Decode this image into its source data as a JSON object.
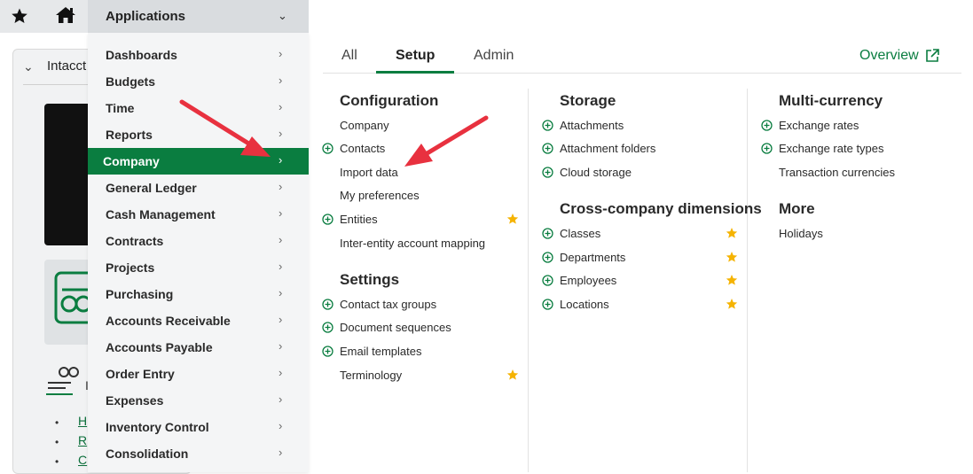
{
  "topbar": {
    "applications_label": "Applications"
  },
  "background": {
    "panel_title": "Intacct",
    "link_1": "H",
    "link_2": "R",
    "link_3": "C",
    "letter": "I"
  },
  "menu": {
    "items": [
      {
        "label": "Dashboards"
      },
      {
        "label": "Budgets"
      },
      {
        "label": "Time"
      },
      {
        "label": "Reports"
      },
      {
        "label": "Company",
        "active": true
      },
      {
        "label": "General Ledger"
      },
      {
        "label": "Cash Management"
      },
      {
        "label": "Contracts"
      },
      {
        "label": "Projects"
      },
      {
        "label": "Purchasing"
      },
      {
        "label": "Accounts Receivable"
      },
      {
        "label": "Accounts Payable"
      },
      {
        "label": "Order Entry"
      },
      {
        "label": "Expenses"
      },
      {
        "label": "Inventory Control"
      },
      {
        "label": "Consolidation"
      }
    ]
  },
  "tabs": [
    {
      "label": "All"
    },
    {
      "label": "Setup",
      "active": true
    },
    {
      "label": "Admin"
    }
  ],
  "overview_label": "Overview",
  "columns": {
    "configuration": {
      "title": "Configuration",
      "items": [
        "Company",
        "Contacts",
        "Import data",
        "My preferences",
        "Entities",
        "Inter-entity account mapping"
      ]
    },
    "settings": {
      "title": "Settings",
      "items": [
        "Contact tax groups",
        "Document sequences",
        "Email templates",
        "Terminology"
      ]
    },
    "storage": {
      "title": "Storage",
      "items": [
        "Attachments",
        "Attachment folders",
        "Cloud storage"
      ]
    },
    "cross_company": {
      "title": "Cross-company dimensions",
      "items": [
        "Classes",
        "Departments",
        "Employees",
        "Locations"
      ]
    },
    "multi_currency": {
      "title": "Multi-currency",
      "items": [
        "Exchange rates",
        "Exchange rate types",
        "Transaction currencies"
      ]
    },
    "more": {
      "title": "More",
      "items": [
        "Holidays"
      ]
    }
  },
  "colors": {
    "accent": "#0a7d40",
    "star": "#f5b301",
    "arrow": "#e8313f"
  }
}
